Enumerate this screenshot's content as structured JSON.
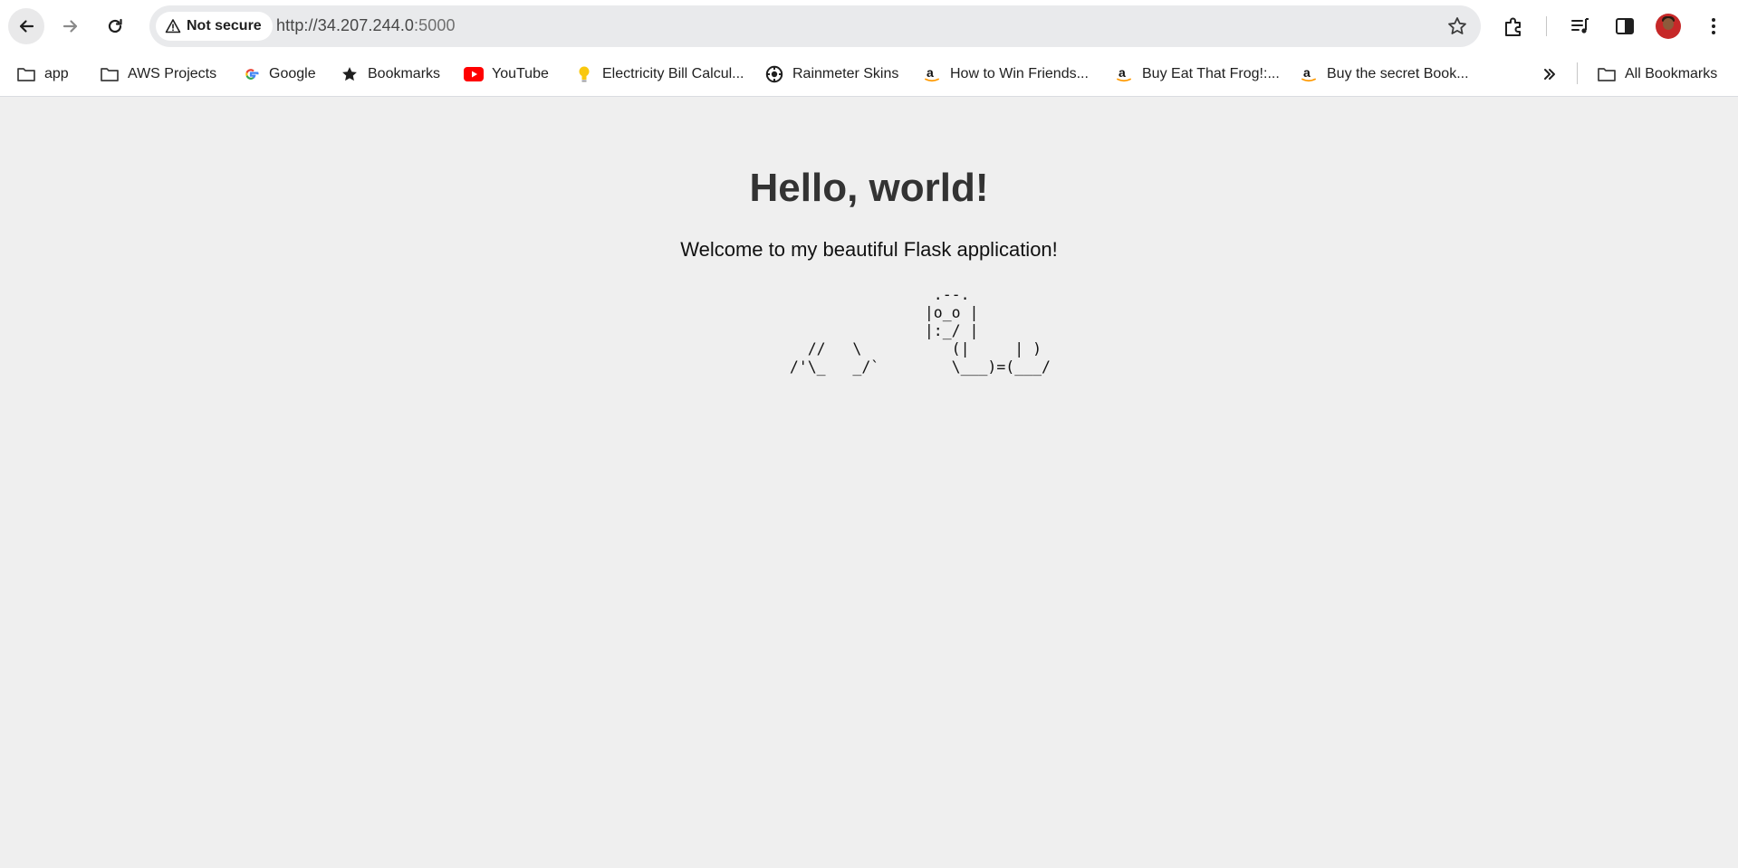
{
  "browser": {
    "security_label": "Not secure",
    "url_host": "http://34.207.244.0",
    "url_port": ":5000"
  },
  "bookmarks": [
    {
      "label": "app",
      "icon": "folder-icon"
    },
    {
      "label": "AWS Projects",
      "icon": "folder-icon"
    },
    {
      "label": "Google",
      "icon": "google-icon"
    },
    {
      "label": "Bookmarks",
      "icon": "star-filled-icon"
    },
    {
      "label": "YouTube",
      "icon": "youtube-icon"
    },
    {
      "label": "Electricity Bill Calcul...",
      "icon": "lightbulb-icon"
    },
    {
      "label": "Rainmeter Skins",
      "icon": "rainmeter-icon"
    },
    {
      "label": "How to Win Friends...",
      "icon": "amazon-icon"
    },
    {
      "label": "Buy Eat That Frog!:...",
      "icon": "amazon-icon"
    },
    {
      "label": "Buy the secret Book...",
      "icon": "amazon-icon"
    }
  ],
  "all_bookmarks_label": "All Bookmarks",
  "page": {
    "heading": "Hello, world!",
    "welcome": "Welcome to my beautiful Flask application!",
    "ascii_art": "                  .--.\n                 |o_o |\n                 |:_/ |\n    //   \\          (|     | )\n  /'\\_   _/`        \\___)=(___/"
  },
  "colors": {
    "page_background": "#efefef",
    "heading": "#333333",
    "omnibox": "#e9eaec"
  }
}
